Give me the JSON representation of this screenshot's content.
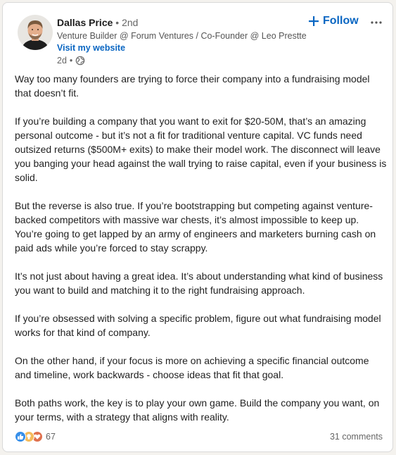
{
  "author": {
    "name": "Dallas Price",
    "separator": "•",
    "degree": "2nd",
    "headline": "Venture Builder @ Forum Ventures / Co-Founder @ Leo Prestte",
    "website_label": "Visit my website"
  },
  "meta": {
    "time": "2d",
    "bullet": "•",
    "visibility_icon": "globe-icon"
  },
  "actions": {
    "follow_label": "Follow",
    "follow_icon": "plus-icon",
    "more_icon": "ellipsis-icon"
  },
  "post": {
    "paragraphs": [
      "Way too many founders are trying to force their company into a fundraising model that doesn’t fit.",
      "If you’re building a company that you want to exit for $20-50M, that’s an amazing personal outcome - but it’s not a fit for traditional venture capital. VC funds need outsized returns ($500M+ exits) to make their model work. The disconnect will leave you banging your head against the wall trying to raise capital, even if your business is solid.",
      "But the reverse is also true. If you’re bootstrapping but competing against venture-backed competitors with massive war chests, it’s almost impossible to keep up. You’re going to get lapped by an army of engineers and marketers burning cash on paid ads while you’re forced to stay scrappy.",
      "It’s not just about having a great idea. It’s about understanding what kind of business you want to build and matching it to the right fundraising approach.",
      "If you’re obsessed with solving a specific problem, figure out what fundraising model works for that kind of company.",
      "On the other hand, if your focus is more on achieving a specific financial outcome and timeline, work backwards - choose ideas that fit that goal.",
      "Both paths work, the key is to play your own game. Build the company you want, on your terms, with a strategy that aligns with reality."
    ]
  },
  "social": {
    "reaction_icons": [
      "like-icon",
      "insightful-icon",
      "love-icon"
    ],
    "reaction_count": "67",
    "comments_label": "31 comments"
  },
  "colors": {
    "link_blue": "#0a66c2",
    "text_primary": "#1d1d1d",
    "text_secondary": "#666666",
    "like_blue": "#378fe9",
    "insightful_yellow": "#f5bb5c",
    "love_red": "#df704d"
  }
}
